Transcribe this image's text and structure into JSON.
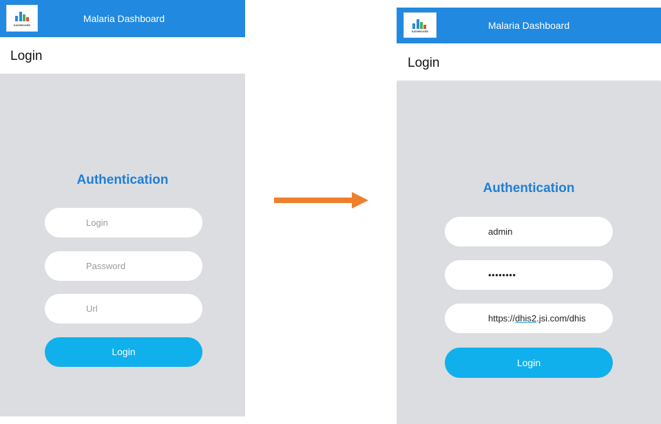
{
  "app": {
    "title": "Malaria Dashboard",
    "logo_text": "DASHBOARD"
  },
  "login_header": "Login",
  "auth_title": "Authentication",
  "before": {
    "login_placeholder": "Login",
    "password_placeholder": "Password",
    "url_placeholder": "Url",
    "button_label": "Login"
  },
  "after": {
    "login_value": "admin",
    "password_value": "••••••••",
    "url_prefix": "https://",
    "url_domain_part": "dhis2",
    "url_suffix": ".jsi.com/dhis",
    "button_label": "Login"
  },
  "colors": {
    "appbar": "#2189e0",
    "accent_title": "#1f7fd6",
    "button": "#0fb0ec",
    "content_bg": "#dcdde0",
    "arrow": "#ee7f2d"
  },
  "icons": [
    "bar-chart-logo-icon",
    "right-arrow-icon"
  ]
}
